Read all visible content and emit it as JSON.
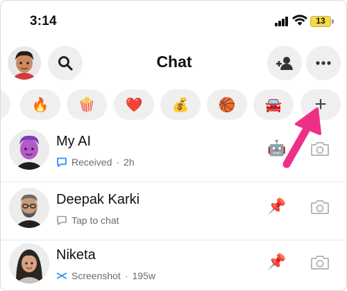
{
  "status_bar": {
    "time": "3:14",
    "battery": "13",
    "signal_icon": "cellular-signal-icon",
    "wifi_icon": "wifi-icon",
    "battery_color": "#f3d94c"
  },
  "header": {
    "title": "Chat",
    "search_icon": "search-icon",
    "add_friend_icon": "add-friend-icon",
    "more_icon": "more-icon"
  },
  "chips": [
    {
      "emoji": "🔥",
      "name": "fire"
    },
    {
      "emoji": "🍿",
      "name": "popcorn"
    },
    {
      "emoji": "❤️",
      "name": "heart"
    },
    {
      "emoji": "💰",
      "name": "money-bag"
    },
    {
      "emoji": "🏀",
      "name": "basketball"
    },
    {
      "emoji": "🚘",
      "name": "car"
    },
    {
      "emoji": "+",
      "name": "add"
    }
  ],
  "chats": [
    {
      "name": "My AI",
      "status": "Received",
      "time": "2h",
      "badge": "🤖",
      "status_icon": "chat-bubble-icon",
      "status_color": "#2f8dff"
    },
    {
      "name": "Deepak Karki",
      "status": "Tap to chat",
      "time": "",
      "badge": "📌",
      "status_icon": "chat-bubble-outline-icon",
      "status_color": "#9a9a9a"
    },
    {
      "name": "Niketa",
      "status": "Screenshot",
      "time": "195w",
      "badge": "📌",
      "status_icon": "screenshot-icon",
      "status_color": "#2f8dff"
    }
  ],
  "accent_arrow_color": "#ee2f87"
}
